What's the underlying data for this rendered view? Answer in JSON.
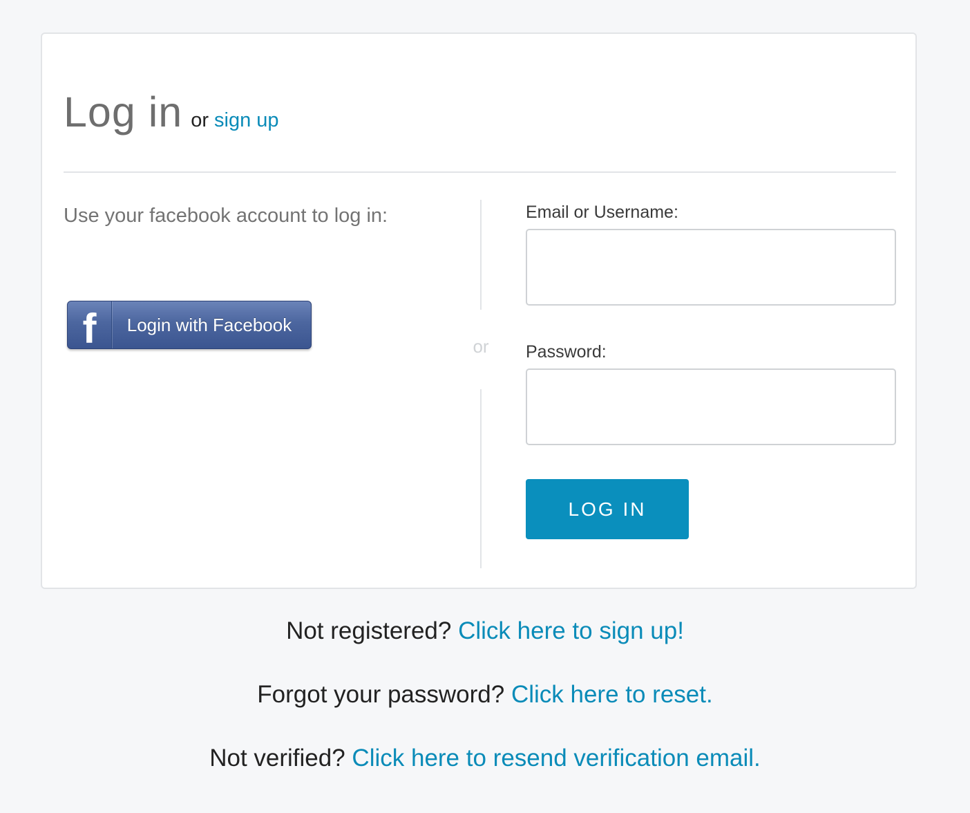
{
  "header": {
    "title": "Log in",
    "or_text": "or",
    "signup_link": "sign up"
  },
  "facebook": {
    "prompt": "Use your facebook account to log in:",
    "button_label": "Login with Facebook",
    "icon_glyph": "f",
    "icon": "facebook-icon",
    "button_color": "#4c669f"
  },
  "divider": {
    "or_text": "or"
  },
  "form": {
    "email_label": "Email or Username:",
    "email_value": "",
    "password_label": "Password:",
    "password_value": "",
    "submit_label": "LOG IN",
    "submit_color": "#0a8fbd"
  },
  "footer": {
    "line1_text": "Not registered? ",
    "line1_link": "Click here to sign up!",
    "line2_text": "Forgot your password? ",
    "line2_link": "Click here to reset.",
    "line3_text": "Not verified? ",
    "line3_link": "Click here to resend verification email."
  },
  "colors": {
    "link": "#0a8bb8",
    "background": "#f6f7f9",
    "card": "#ffffff"
  }
}
